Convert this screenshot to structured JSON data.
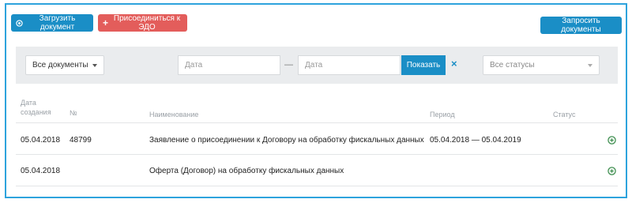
{
  "toolbar": {
    "upload_label": "Загрузить документ",
    "join_label": "Присоединиться к ЭДО",
    "request_label": "Запросить документы"
  },
  "filters": {
    "doc_type": "Все документы",
    "date_from_placeholder": "Дата",
    "date_separator": "—",
    "date_to_placeholder": "Дата",
    "show_label": "Показать",
    "clear_symbol": "×",
    "status": "Все статусы"
  },
  "table": {
    "headers": {
      "created_line1": "Дата",
      "created_line2": "создания",
      "number": "№",
      "name": "Наименование",
      "period": "Период",
      "status": "Статус"
    },
    "rows": [
      {
        "created": "05.04.2018",
        "number": "48799",
        "name": "Заявление о присоединении к Договору на обработку фискальных данных",
        "period": "05.04.2018 — 05.04.2019",
        "status": ""
      },
      {
        "created": "05.04.2018",
        "number": "",
        "name": "Оферта (Договор) на обработку фискальных данных",
        "period": "",
        "status": ""
      }
    ]
  },
  "colors": {
    "accent_blue": "#1a8ec6",
    "danger_red": "#e35d5b",
    "frame_border": "#2ea3dd",
    "add_icon_green": "#3e8e4f"
  },
  "icons": {
    "upload": "circle-dot-icon",
    "join": "plus-icon",
    "row_action": "add-circle-icon"
  }
}
